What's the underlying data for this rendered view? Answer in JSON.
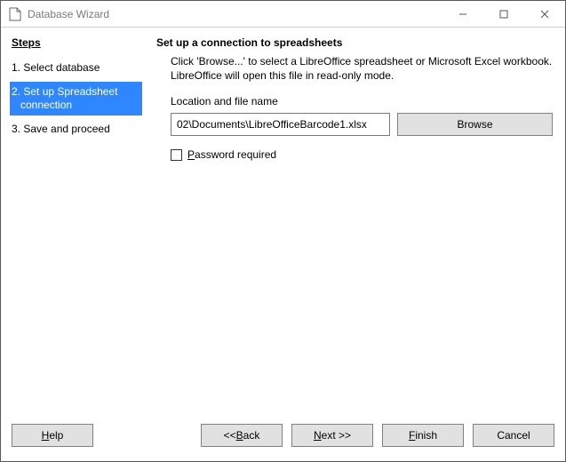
{
  "window": {
    "title": "Database Wizard"
  },
  "sidebar": {
    "heading": "Steps",
    "items": [
      {
        "label": "1. Select database",
        "active": false
      },
      {
        "label": "2. Set up Spreadsheet connection",
        "active": true
      },
      {
        "label": "3. Save and proceed",
        "active": false
      }
    ]
  },
  "main": {
    "heading": "Set up a connection to spreadsheets",
    "description": "Click 'Browse...' to select a LibreOffice spreadsheet or Microsoft Excel workbook.\nLibreOffice will open this file in read-only mode.",
    "location_label": "Location and file name",
    "location_value": "02\\Documents\\LibreOfficeBarcode1.xlsx",
    "browse_label": "Browse",
    "password_label": "Password required",
    "password_checked": false
  },
  "footer": {
    "help": "Help",
    "back": "<< Back",
    "next": "Next >>",
    "finish": "Finish",
    "cancel": "Cancel"
  }
}
